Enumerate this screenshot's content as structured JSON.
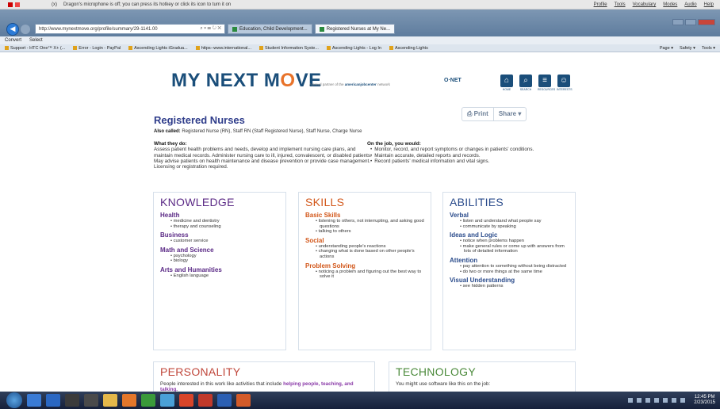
{
  "dragon": {
    "close_mark": "(x)",
    "message": "Dragon's microphone is off; you can press its hotkey or click its icon to turn it on",
    "menus": [
      "Profile",
      "Tools",
      "Vocabulary",
      "Modes",
      "Audio",
      "Help"
    ]
  },
  "browser": {
    "address": "http://www.mynextmove.org/profile/summary/29-1141.00",
    "address_controls": "⌕ ▾ ☰ ↻ ✕",
    "tabs": [
      {
        "label": "Education, Child Development...",
        "active": false
      },
      {
        "label": "Registered Nurses at My Ne...",
        "active": true
      }
    ],
    "commandbar": [
      "Convert",
      "Select"
    ],
    "favorites": [
      "Support - HTC One™ X+ (...",
      "Error - Login - PayPal",
      "Ascending Lights iGradua...",
      "https--www.international...",
      "Student Information Syste...",
      "Ascending Lights - Log In",
      "Ascending Lights"
    ],
    "tools": [
      "Page ▾",
      "Safety ▾",
      "Tools ▾"
    ],
    "home_icons": "⌂ ★ ⚙"
  },
  "site": {
    "logo_pre": "MY NEXT M",
    "logo_o": "O",
    "logo_post": "VE",
    "partner_pre": "A proud partner of the",
    "partner_brand": "americanjobcenter",
    "partner_post": "network",
    "onet": "O·NET",
    "nav": [
      {
        "glyph": "⌂",
        "label": "HOME"
      },
      {
        "glyph": "⌕",
        "label": "SEARCH"
      },
      {
        "glyph": "≡",
        "label": "RESOURCES"
      },
      {
        "glyph": "☺",
        "label": "INTERESTS"
      }
    ]
  },
  "career": {
    "title": "Registered Nurses",
    "print_label": "⎙ Print",
    "share_label": "Share ▾",
    "also_called_label": "Also called:",
    "also_called": "Registered Nurse (RN), Staff RN (Staff Registered Nurse), Staff Nurse, Charge Nurse",
    "what_they_do_label": "What they do:",
    "what_they_do": "Assess patient health problems and needs, develop and implement nursing care plans, and maintain medical records. Administer nursing care to ill, injured, convalescent, or disabled patients. May advise patients on health maintenance and disease prevention or provide case management. Licensing or registration required.",
    "on_the_job_label": "On the job, you would:",
    "on_the_job": [
      "Monitor, record, and report symptoms or changes in patients' conditions.",
      "Maintain accurate, detailed reports and records.",
      "Record patients' medical information and vital signs."
    ]
  },
  "knowledge": {
    "title": "KNOWLEDGE",
    "sections": [
      {
        "name": "Health",
        "items": [
          "medicine and dentistry",
          "therapy and counseling"
        ]
      },
      {
        "name": "Business",
        "items": [
          "customer service"
        ]
      },
      {
        "name": "Math and Science",
        "items": [
          "psychology",
          "biology"
        ]
      },
      {
        "name": "Arts and Humanities",
        "items": [
          "English language"
        ]
      }
    ]
  },
  "skills": {
    "title": "SKILLS",
    "sections": [
      {
        "name": "Basic Skills",
        "items": [
          "listening to others, not interrupting, and asking good questions",
          "talking to others"
        ]
      },
      {
        "name": "Social",
        "items": [
          "understanding people's reactions",
          "changing what is done based on other people's actions"
        ]
      },
      {
        "name": "Problem Solving",
        "items": [
          "noticing a problem and figuring out the best way to solve it"
        ]
      }
    ]
  },
  "abilities": {
    "title": "ABILITIES",
    "sections": [
      {
        "name": "Verbal",
        "items": [
          "listen and understand what people say",
          "communicate by speaking"
        ]
      },
      {
        "name": "Ideas and Logic",
        "items": [
          "notice when problems happen",
          "make general rules or come up with answers from lots of detailed information"
        ]
      },
      {
        "name": "Attention",
        "items": [
          "pay attention to something without being distracted",
          "do two or more things at the same time"
        ]
      },
      {
        "name": "Visual Understanding",
        "items": [
          "see hidden patterns"
        ]
      }
    ]
  },
  "personality": {
    "title": "PERSONALITY",
    "text": "People interested in this work like activities that include",
    "highlight": "helping people, teaching, and talking."
  },
  "technology": {
    "title": "TECHNOLOGY",
    "text": "You might use software like this on the job:"
  },
  "taskbar": {
    "time": "12:45 PM",
    "date": "2/23/2015"
  },
  "colors": {
    "knowledge": "#5b2a86",
    "skills": "#d2571a",
    "abilities": "#2a4b8b",
    "brand_blue": "#1a4e7a",
    "brand_orange": "#e8732a"
  }
}
